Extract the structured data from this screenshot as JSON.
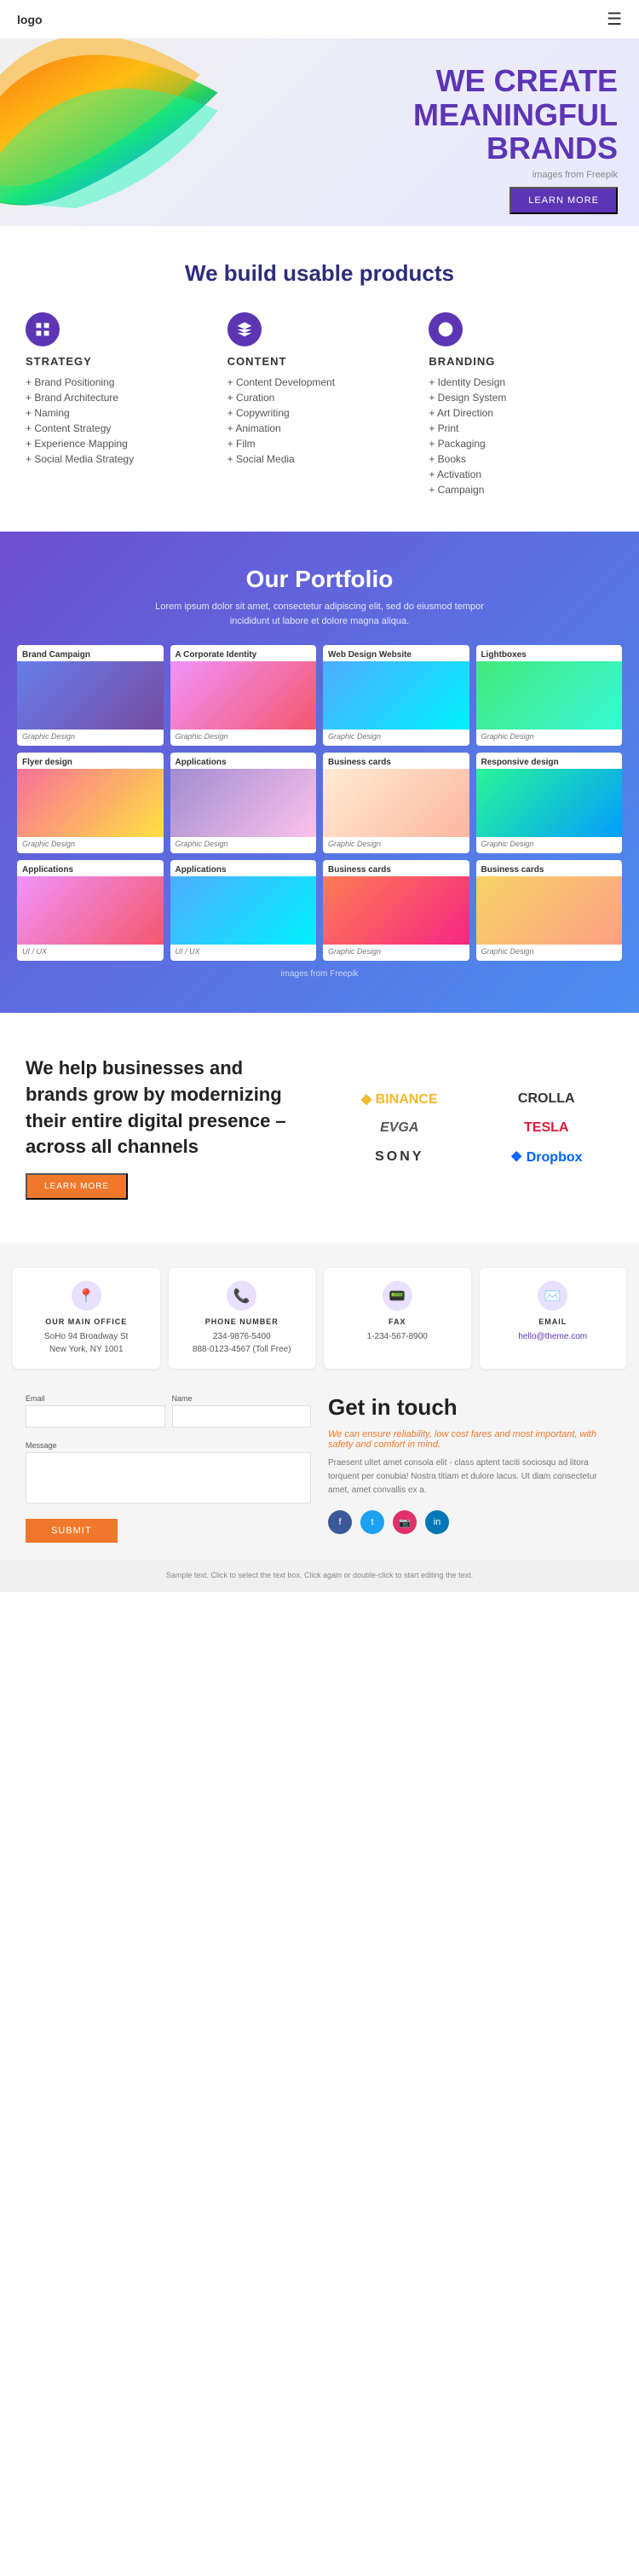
{
  "header": {
    "logo": "logo",
    "hamburger_label": "☰"
  },
  "hero": {
    "title_line1": "WE CREATE",
    "title_line2": "MEANINGFUL",
    "title_line3": "BRANDS",
    "subtitle": "images from Freepik",
    "btn_label": "LEARN MORE"
  },
  "products": {
    "section_title": "We build usable products",
    "columns": [
      {
        "id": "strategy",
        "title": "STRATEGY",
        "items": [
          "Brand Positioning",
          "Brand Architecture",
          "Naming",
          "Content Strategy",
          "Experience Mapping",
          "Social Media Strategy"
        ]
      },
      {
        "id": "content",
        "title": "CONTENT",
        "items": [
          "Content Development",
          "Curation",
          "Copywriting",
          "Animation",
          "Film",
          "Social Media"
        ]
      },
      {
        "id": "branding",
        "title": "BRANDING",
        "items": [
          "Identity Design",
          "Design System",
          "Art Direction",
          "Print",
          "Packaging",
          "Books",
          "Activation",
          "Campaign"
        ]
      }
    ]
  },
  "portfolio": {
    "title": "Our Portfolio",
    "description": "Lorem ipsum dolor sit amet, consectetur adipiscing elit, sed do eiusmod tempor incididunt ut labore et dolore magna aliqua.",
    "freepik_text": "images from Freepik",
    "cards": [
      {
        "title": "Brand Campaign",
        "category": "Graphic Design",
        "img_class": "img-brand-campaign"
      },
      {
        "title": "A Corporate Identity",
        "category": "Graphic Design",
        "img_class": "img-corporate"
      },
      {
        "title": "Web Design Website",
        "category": "Graphic Design",
        "img_class": "img-webdesign"
      },
      {
        "title": "Lightboxes",
        "category": "Graphic Design",
        "img_class": "img-lightboxes"
      },
      {
        "title": "Flyer design",
        "category": "Graphic Design",
        "img_class": "img-flyer"
      },
      {
        "title": "Applications",
        "category": "Graphic Design",
        "img_class": "img-applications"
      },
      {
        "title": "Business cards",
        "category": "Graphic Design",
        "img_class": "img-bcards"
      },
      {
        "title": "Responsive design",
        "category": "Graphic Design",
        "img_class": "img-responsive"
      },
      {
        "title": "Applications",
        "category": "UI / UX",
        "img_class": "img-app-ux"
      },
      {
        "title": "Applications",
        "category": "UI / UX",
        "img_class": "img-app-ux2"
      },
      {
        "title": "Business cards",
        "category": "Graphic Design",
        "img_class": "img-bcards2"
      },
      {
        "title": "Business cards",
        "category": "Graphic Design",
        "img_class": "img-bcards3"
      }
    ]
  },
  "brands": {
    "heading": "We help businesses and brands grow by modernizing their entire digital presence – across all channels",
    "btn_label": "LEARN MORE",
    "logos": [
      "BINANCE",
      "CROLLA",
      "EVGA",
      "TESLA",
      "SONY",
      "Dropbox"
    ]
  },
  "contact_info": {
    "items": [
      {
        "label": "OUR MAIN OFFICE",
        "value": "SoHo 94 Broadway St\nNew York, NY 1001",
        "icon": "📍"
      },
      {
        "label": "PHONE NUMBER",
        "value": "234-9876-5400\n888-0123-4567 (Toll Free)",
        "icon": "📞"
      },
      {
        "label": "FAX",
        "value": "1-234-567-8900",
        "icon": "📟"
      },
      {
        "label": "EMAIL",
        "value": "hello@theme.com",
        "icon": "✉️",
        "is_link": true
      }
    ]
  },
  "get_in_touch": {
    "title": "Get in touch",
    "description": "We can ensure reliability, low cost fares and most important, with safety and comfort in mind.",
    "body_text": "Praesent ultet amet consola elit - class aptent taciti sociosqu ad litora torquent per conubia! Nostra titiam et dulore lacus. Ut diam consectetur amet, amet convallis ex a.",
    "form": {
      "email_label": "Email",
      "name_label": "Name",
      "message_label": "Message",
      "email_placeholder": "",
      "name_placeholder": "",
      "message_placeholder": "",
      "submit_label": "SUBMIT"
    },
    "social": [
      "f",
      "t",
      "in",
      "in"
    ]
  },
  "footer": {
    "text": "Sample text. Click to select the text box. Click again or double-click to start editing the text."
  }
}
